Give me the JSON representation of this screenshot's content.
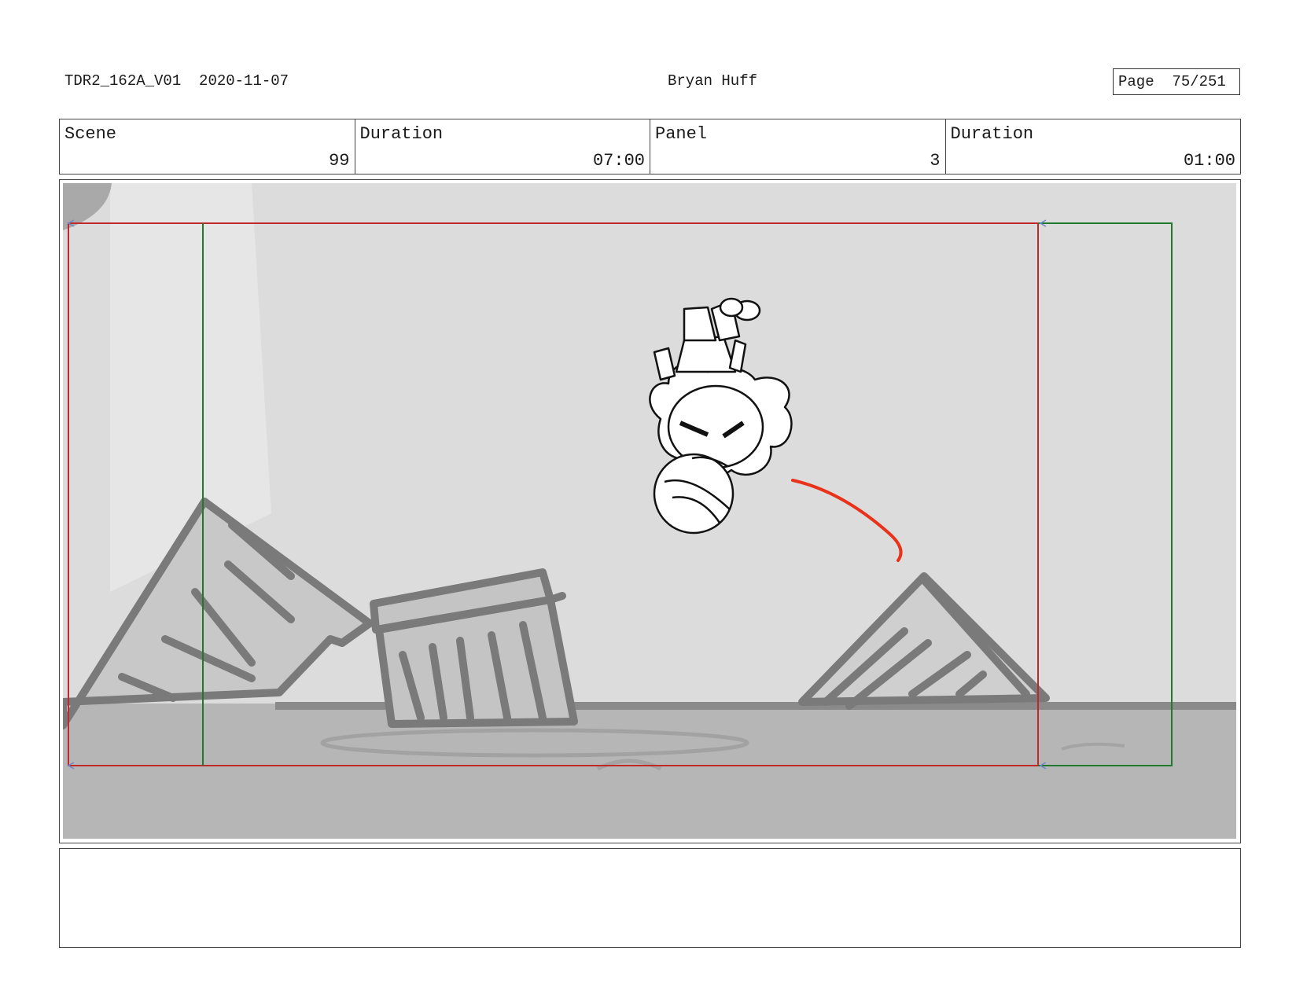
{
  "header": {
    "production": "TDR2_162A_V01",
    "date": "2020-11-07",
    "artist": "Bryan Huff",
    "page_label": "Page",
    "page_value": "75/251"
  },
  "info": {
    "scene_label": "Scene",
    "scene_value": "99",
    "scene_duration_label": "Duration",
    "scene_duration_value": "07:00",
    "panel_label": "Panel",
    "panel_value": "3",
    "panel_duration_label": "Duration",
    "panel_duration_value": "01:00"
  },
  "colors": {
    "safe_frame": "#c0282a",
    "camera_frame": "#1f7a2e",
    "motion_line": "#e8321a",
    "sketch_gray": "#7a7a7a",
    "bg_wall": "#dcdcdc",
    "bg_floor": "#b4b4b4"
  },
  "notes": ""
}
